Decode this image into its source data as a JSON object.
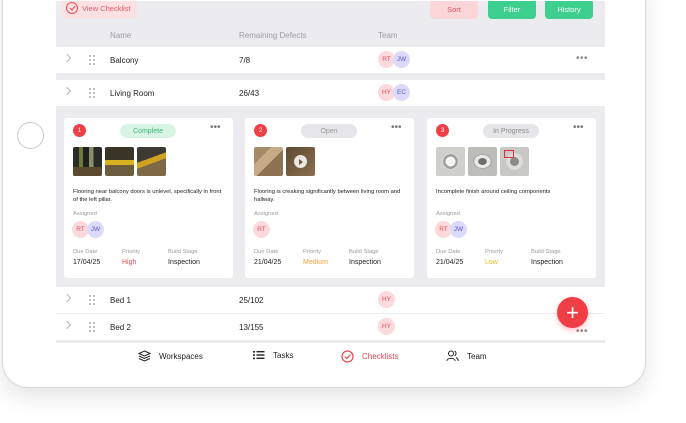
{
  "toolbar": {
    "view_checklist": "View Checklist",
    "sort": "Sort",
    "filter": "Filter",
    "history": "History"
  },
  "table": {
    "headers": {
      "name": "Name",
      "remaining_defects": "Remaining Defects",
      "team": "Team"
    },
    "rows": [
      {
        "name": "Balcony",
        "defects": "7/8",
        "team": [
          "RT",
          "JW"
        ]
      },
      {
        "name": "Living Room",
        "defects": "26/43",
        "team": [
          "HY",
          "EC"
        ]
      },
      {
        "name": "Bed 1",
        "defects": "25/102",
        "team": [
          "HY"
        ]
      },
      {
        "name": "Bed 2",
        "defects": "13/155",
        "team": [
          "HY"
        ]
      }
    ]
  },
  "defects": [
    {
      "number": "1",
      "status": "Complete",
      "description": "Flooring near balcony doors is unlevel, specifically in front of the left pillar.",
      "assigned_label": "Assigned",
      "assignees": [
        "RT",
        "JW"
      ],
      "due_label": "Due Date",
      "due": "17/04/25",
      "priority_label": "Priority",
      "priority": "High",
      "stage_label": "Build Stage",
      "stage": "Inspection"
    },
    {
      "number": "2",
      "status": "Open",
      "description": "Flooring is creaking significantly between living room and hallway.",
      "assigned_label": "Assigned",
      "assignees": [
        "RT"
      ],
      "due_label": "Due Date",
      "due": "21/04/25",
      "priority_label": "Priority",
      "priority": "Medium",
      "stage_label": "Build Stage",
      "stage": "Inspection"
    },
    {
      "number": "3",
      "status": "In Progress",
      "description": "Incomplete finish around ceiling components",
      "assigned_label": "Assigned",
      "assignees": [
        "RT",
        "JW"
      ],
      "due_label": "Due Date",
      "due": "21/04/25",
      "priority_label": "Priority",
      "priority": "Low",
      "stage_label": "Build Stage",
      "stage": "Inspection"
    }
  ],
  "nav": {
    "workspaces": "Workspaces",
    "tasks": "Tasks",
    "checklists": "Checklists",
    "team": "Team"
  },
  "fab": {
    "label": "+"
  },
  "more_glyph": "•••",
  "colors": {
    "accent": "#f03e47",
    "green": "#3ccf8e",
    "pink_bg": "#fcd9dc",
    "purple_bg": "#dcdafa"
  }
}
